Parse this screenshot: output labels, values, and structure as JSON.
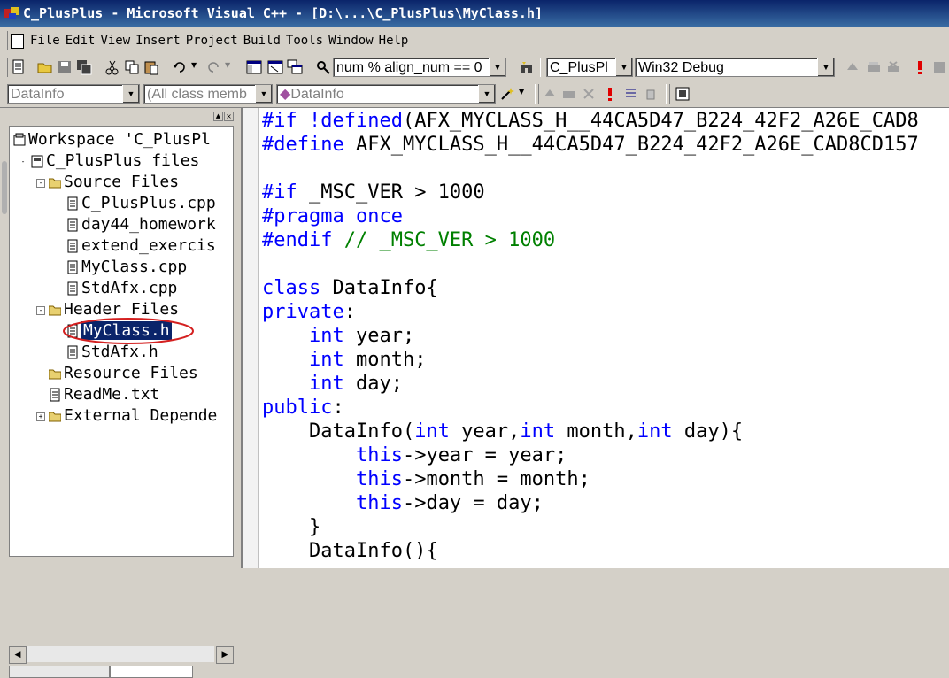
{
  "window": {
    "title": "C_PlusPlus - Microsoft Visual C++ - [D:\\...\\C_PlusPlus\\MyClass.h]"
  },
  "menu": {
    "items": [
      "File",
      "Edit",
      "View",
      "Insert",
      "Project",
      "Build",
      "Tools",
      "Window",
      "Help"
    ]
  },
  "toolbar1": {
    "find_combo": "num % align_num == 0",
    "project_combo": "C_PlusPl",
    "config_combo": "Win32 Debug"
  },
  "toolbar2": {
    "class_combo": "DataInfo",
    "members_combo": "(All class memb",
    "function_combo": "DataInfo"
  },
  "workspace": {
    "items": [
      {
        "label": "Workspace 'C_PlusPl",
        "icon": "workspace-icon"
      },
      {
        "label": "C_PlusPlus files",
        "icon": "project-icon"
      },
      {
        "label": "Source Files",
        "icon": "folder-icon"
      },
      {
        "label": "C_PlusPlus.cpp",
        "icon": "file-icon"
      },
      {
        "label": "day44_homework",
        "icon": "file-icon"
      },
      {
        "label": "extend_exercis",
        "icon": "file-icon"
      },
      {
        "label": "MyClass.cpp",
        "icon": "file-icon"
      },
      {
        "label": "StdAfx.cpp",
        "icon": "file-icon"
      },
      {
        "label": "Header Files",
        "icon": "folder-icon"
      },
      {
        "label": "MyClass.h",
        "icon": "file-icon"
      },
      {
        "label": "StdAfx.h",
        "icon": "file-icon"
      },
      {
        "label": "Resource Files",
        "icon": "folder-icon"
      },
      {
        "label": "ReadMe.txt",
        "icon": "file-icon"
      },
      {
        "label": "External Depende",
        "icon": "folder-icon"
      }
    ],
    "selected": "MyClass.h"
  },
  "code": {
    "lines": [
      [
        [
          "kw",
          "#if !defined"
        ],
        [
          "tx",
          "(AFX_MYCLASS_H__44CA5D47_B224_42F2_A26E_CAD8"
        ]
      ],
      [
        [
          "kw",
          "#define "
        ],
        [
          "tx",
          "AFX_MYCLASS_H__44CA5D47_B224_42F2_A26E_CAD8CD157"
        ]
      ],
      [],
      [
        [
          "kw",
          "#if "
        ],
        [
          "tx",
          "_MSC_VER > 1000"
        ]
      ],
      [
        [
          "kw",
          "#pragma once"
        ]
      ],
      [
        [
          "kw",
          "#endif "
        ],
        [
          "cm",
          "// _MSC_VER > 1000"
        ]
      ],
      [],
      [
        [
          "kw",
          "class "
        ],
        [
          "tx",
          "DataInfo{"
        ]
      ],
      [
        [
          "kw",
          "private"
        ],
        [
          "tx",
          ":"
        ]
      ],
      [
        [
          "tx",
          "    "
        ],
        [
          "kw",
          "int "
        ],
        [
          "tx",
          "year;"
        ]
      ],
      [
        [
          "tx",
          "    "
        ],
        [
          "kw",
          "int "
        ],
        [
          "tx",
          "month;"
        ]
      ],
      [
        [
          "tx",
          "    "
        ],
        [
          "kw",
          "int "
        ],
        [
          "tx",
          "day;"
        ]
      ],
      [
        [
          "kw",
          "public"
        ],
        [
          "tx",
          ":"
        ]
      ],
      [
        [
          "tx",
          "    DataInfo("
        ],
        [
          "kw",
          "int "
        ],
        [
          "tx",
          "year,"
        ],
        [
          "kw",
          "int "
        ],
        [
          "tx",
          "month,"
        ],
        [
          "kw",
          "int "
        ],
        [
          "tx",
          "day){"
        ]
      ],
      [
        [
          "tx",
          "        "
        ],
        [
          "kw",
          "this"
        ],
        [
          "tx",
          "->year = year;"
        ]
      ],
      [
        [
          "tx",
          "        "
        ],
        [
          "kw",
          "this"
        ],
        [
          "tx",
          "->month = month;"
        ]
      ],
      [
        [
          "tx",
          "        "
        ],
        [
          "kw",
          "this"
        ],
        [
          "tx",
          "->day = day;"
        ]
      ],
      [
        [
          "tx",
          "    }"
        ]
      ],
      [
        [
          "tx",
          "    DataInfo(){"
        ]
      ]
    ]
  },
  "colors": {
    "keyword": "#0000ff",
    "comment": "#008000",
    "selection": "#0a246a",
    "annotation_circle": "#d42020"
  }
}
